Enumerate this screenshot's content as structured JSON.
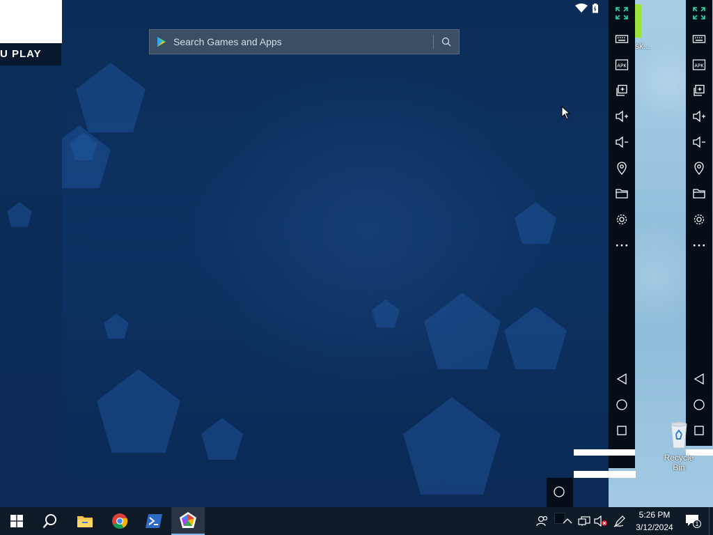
{
  "left_window": {
    "brand_text": "U PLAY"
  },
  "search": {
    "placeholder": "Search Games and Apps"
  },
  "desktop": {
    "partial_label": "sk...",
    "recycle_bin_label": "Recycle Bin"
  },
  "taskbar": {
    "time": "5:26 PM",
    "date": "3/12/2024",
    "notification_count": "1"
  },
  "colors": {
    "emulator_bg": "#0c3263",
    "toolbar_bg": "#050d18",
    "accent_green": "#2fd8a8",
    "taskbar_bg": "#0f1a27"
  }
}
